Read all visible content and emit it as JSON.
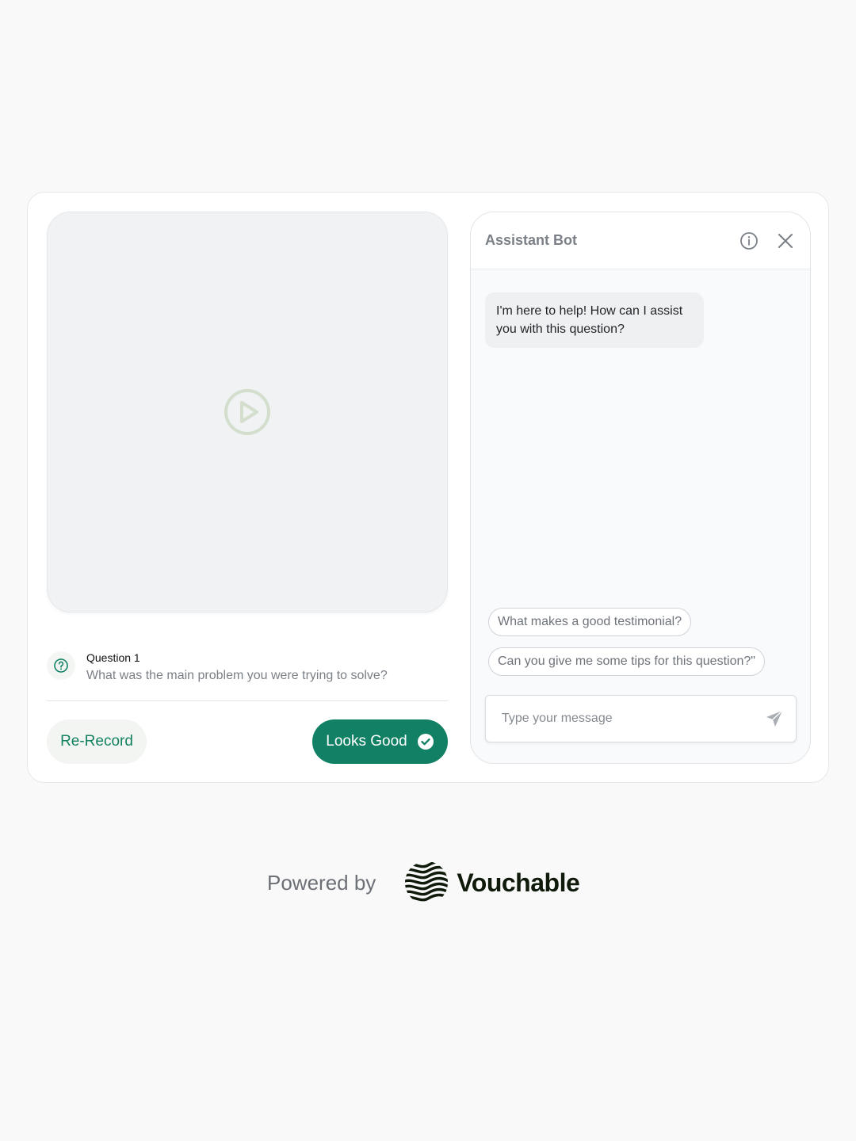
{
  "video": {
    "play_icon": "play-circle-icon"
  },
  "question": {
    "label": "Question 1",
    "text": "What was the main problem you were trying to solve?",
    "icon": "question-circle-icon"
  },
  "actions": {
    "rerecord_label": "Re-Record",
    "looks_good_label": "Looks Good"
  },
  "chat": {
    "title": "Assistant Bot",
    "bot_message": "I'm here to help! How can I assist you with this question?",
    "suggestions": [
      "What makes a good testimonial?",
      "Can you give me some tips for this question?\""
    ],
    "input_placeholder": "Type your message"
  },
  "footer": {
    "powered_by": "Powered by",
    "brand": "Vouchable"
  },
  "colors": {
    "accent": "#118064",
    "accent_text": "#138260",
    "background": "#f9f9f9"
  }
}
